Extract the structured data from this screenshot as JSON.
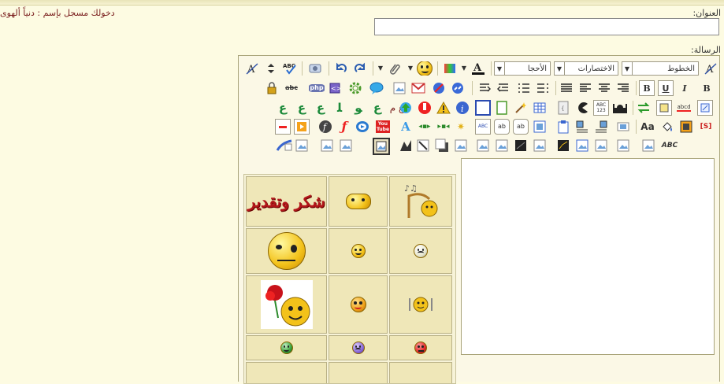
{
  "page": {
    "title_label": "العنوان:",
    "message_label": "الرسالة:",
    "login_status": "دخولك مسجل بإسم : دنياً ألهوى"
  },
  "title_input": {
    "value": ""
  },
  "toolbar": {
    "font_select": "الخطوط",
    "shortcuts_select": "الاختصارات",
    "size_select": "الأحجا",
    "arabic_letters": [
      "ع",
      "ع",
      "ع",
      "ﻠ",
      "ﻮ",
      "ع",
      "ع م"
    ],
    "icon_labels": {
      "abc": "ABC",
      "php": "php",
      "youtube": "You\nTube",
      "abc_small": "abc",
      "abc_numbers": "ABC\n123",
      "bold": "B",
      "underline": "U",
      "italic": "I",
      "bold2": "B",
      "aa": "Aa",
      "dollar": "[S]",
      "abc_bold": "ABC",
      "abcd": "abcd",
      "ab": "ab"
    }
  },
  "smilies": {
    "thanks_text": "شكر وتقدير"
  },
  "colors": {
    "background": "#fdfbe2",
    "accent_red": "#7a1e1e",
    "panel": "#efe7b8"
  }
}
